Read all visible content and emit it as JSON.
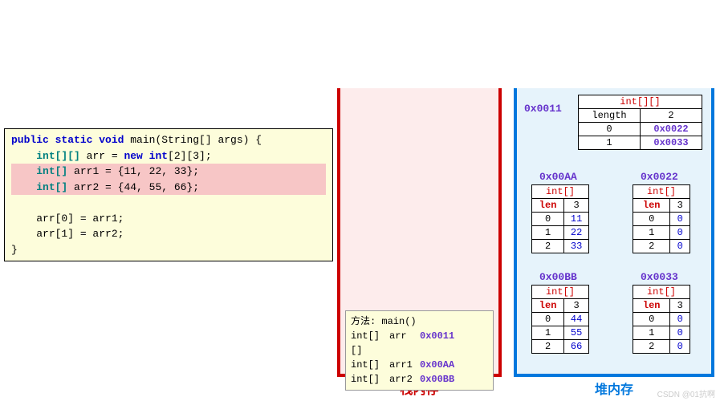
{
  "code": {
    "sig_prefix": "public static void",
    "sig_name": " main(String[] args) {",
    "line2_type": "int[][]",
    "line2_rest": " arr = ",
    "line2_new": "new int",
    "line2_dims": "[2][3];",
    "line3_type": "int[]",
    "line3_rest": " arr1 = {11, 22, 33};",
    "line4_type": "int[]",
    "line4_rest": " arr2 = {44, 55, 66};",
    "line6": "arr[0] = arr1;",
    "line7": "arr[1] = arr2;",
    "close": "}"
  },
  "stack": {
    "label": "栈内存",
    "frame_title": "方法: main()",
    "vars": [
      {
        "type": "int[][]",
        "name": "arr",
        "addr": "0x0011"
      },
      {
        "type": "int[]",
        "name": "arr1",
        "addr": "0x00AA"
      },
      {
        "type": "int[]",
        "name": "arr2",
        "addr": "0x00BB"
      }
    ]
  },
  "heap": {
    "label": "堆内存",
    "outer": {
      "addr": "0x0011",
      "type": "int[][]",
      "length_label": "length",
      "length": "2",
      "rows": [
        {
          "idx": "0",
          "val": "0x0022"
        },
        {
          "idx": "1",
          "val": "0x0033"
        }
      ]
    },
    "objs": [
      {
        "addr": "0x00AA",
        "type": "int[]",
        "len_label": "len",
        "len": "3",
        "rows": [
          {
            "idx": "0",
            "val": "11"
          },
          {
            "idx": "1",
            "val": "22"
          },
          {
            "idx": "2",
            "val": "33"
          }
        ]
      },
      {
        "addr": "0x0022",
        "type": "int[]",
        "len_label": "len",
        "len": "3",
        "rows": [
          {
            "idx": "0",
            "val": "0"
          },
          {
            "idx": "1",
            "val": "0"
          },
          {
            "idx": "2",
            "val": "0"
          }
        ]
      },
      {
        "addr": "0x00BB",
        "type": "int[]",
        "len_label": "len",
        "len": "3",
        "rows": [
          {
            "idx": "0",
            "val": "44"
          },
          {
            "idx": "1",
            "val": "55"
          },
          {
            "idx": "2",
            "val": "66"
          }
        ]
      },
      {
        "addr": "0x0033",
        "type": "int[]",
        "len_label": "len",
        "len": "3",
        "rows": [
          {
            "idx": "0",
            "val": "0"
          },
          {
            "idx": "1",
            "val": "0"
          },
          {
            "idx": "2",
            "val": "0"
          }
        ]
      }
    ]
  },
  "watermark": "CSDN @01抗啊"
}
